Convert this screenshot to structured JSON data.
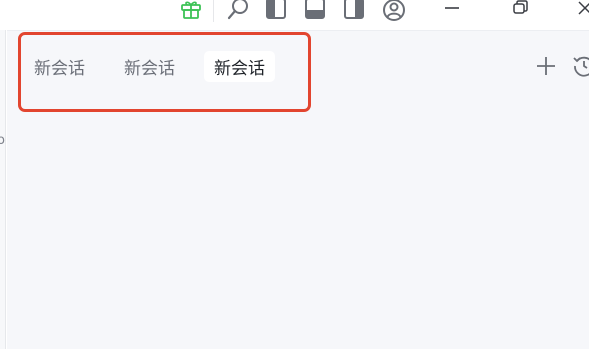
{
  "window": {
    "controls": {
      "gift": "gift-icon",
      "search": "search-icon",
      "left_panel": "left-panel-layout-icon",
      "bottom_panel": "bottom-panel-layout-icon",
      "right_panel": "right-panel-layout-icon",
      "account": "account-icon",
      "minimize": "minimize-icon",
      "restore": "restore-icon",
      "close": "close-icon"
    }
  },
  "tabs": [
    {
      "label": "新会话",
      "active": false
    },
    {
      "label": "新会话",
      "active": false
    },
    {
      "label": "新会话",
      "active": true
    }
  ],
  "tab_actions": {
    "add": "plus-icon",
    "history": "history-icon"
  },
  "colors": {
    "accent_gift": "#3cc255",
    "highlight": "#e2452f",
    "active_tab_bg": "#ffffff",
    "panel_bg": "#f6f7fa"
  }
}
